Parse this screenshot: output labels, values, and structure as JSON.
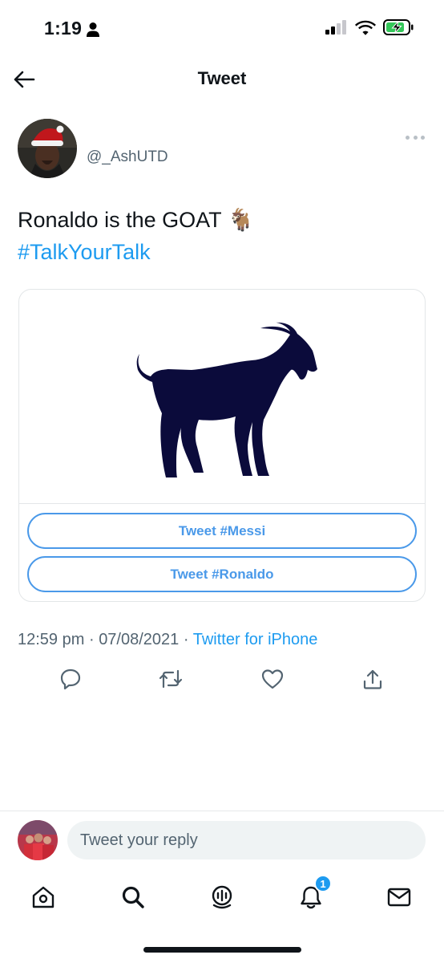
{
  "status_bar": {
    "time": "1:19"
  },
  "header": {
    "title": "Tweet"
  },
  "author": {
    "handle": "@_AshUTD"
  },
  "tweet": {
    "text": "Ronaldo is the GOAT",
    "emoji": "🐐",
    "hashtag": "#TalkYourTalk"
  },
  "card": {
    "buttons": [
      "Tweet #Messi",
      "Tweet #Ronaldo"
    ]
  },
  "meta": {
    "time": "12:59 pm",
    "date": "07/08/2021",
    "separator": "·",
    "source": "Twitter for iPhone"
  },
  "reply": {
    "placeholder": "Tweet your reply"
  },
  "tabbar": {
    "notifications_badge": "1"
  },
  "colors": {
    "accent": "#1d9bf0",
    "card_button": "#4a99e9",
    "goat": "#0b0b3b",
    "secondary_text": "#536471"
  }
}
